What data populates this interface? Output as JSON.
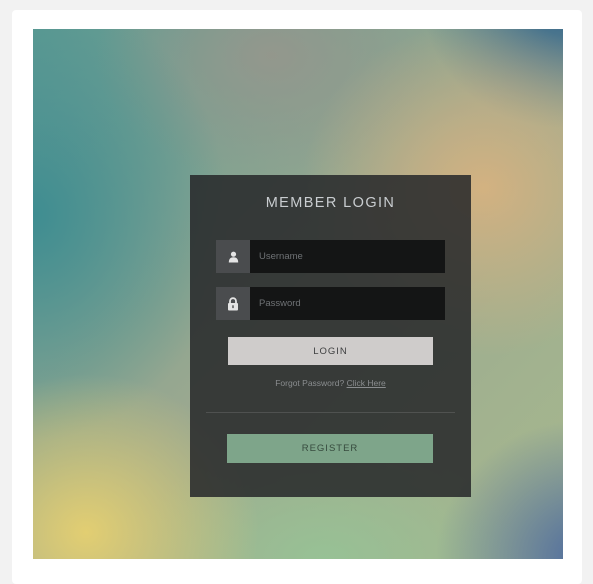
{
  "login_panel": {
    "title": "MEMBER LOGIN",
    "username_field": {
      "placeholder": "Username",
      "value": "",
      "icon": "user-icon"
    },
    "password_field": {
      "placeholder": "Password",
      "value": "",
      "icon": "lock-icon"
    },
    "login_button_label": "LOGIN",
    "forgot_text": "Forgot Password?",
    "forgot_link": "Click Here",
    "register_button_label": "REGISTER"
  },
  "colors": {
    "page_background": "#f2f2f2",
    "panel_background": "#26282a",
    "login_button": "#cfcccb",
    "register_button": "#7ea58a",
    "input_background": "#141515",
    "icon_box": "#4a4c4e"
  }
}
